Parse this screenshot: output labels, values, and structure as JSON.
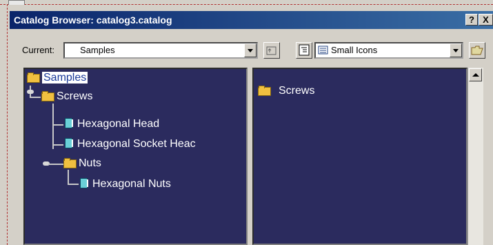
{
  "window": {
    "title": "Catalog Browser: catalog3.catalog",
    "help_label": "?",
    "close_label": "X"
  },
  "toolbar": {
    "current_label": "Current:",
    "current_value": "Samples",
    "view_mode_value": "Small Icons"
  },
  "tree": {
    "root": "Samples",
    "screws": "Screws",
    "hex_head": "Hexagonal Head",
    "hex_socket": "Hexagonal Socket Heac",
    "nuts": "Nuts",
    "hex_nuts": "Hexagonal Nuts"
  },
  "list": {
    "items": [
      "Screws"
    ]
  },
  "colors": {
    "titlebar_start": "#0a246a",
    "titlebar_end": "#3a6ea5",
    "panel_bg": "#2b2b5e",
    "selection_bg": "#ffffff"
  }
}
